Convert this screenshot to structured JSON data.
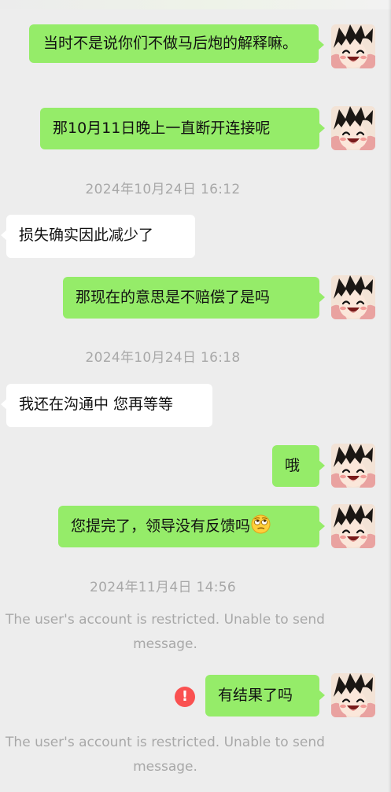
{
  "messages": [
    {
      "id": "m1",
      "text": "当时不是说你们不做马后炮的解释嘛。"
    },
    {
      "id": "m2",
      "text": "那10月11日晚上一直断开连接呢"
    },
    {
      "id": "t1",
      "text": "2024年10月24日 16:12"
    },
    {
      "id": "m3",
      "text": "损失确实因此减少了"
    },
    {
      "id": "m4",
      "text": "那现在的意思是不赔偿了是吗"
    },
    {
      "id": "t2",
      "text": "2024年10月24日 16:18"
    },
    {
      "id": "m5",
      "text": "我还在沟通中 您再等等"
    },
    {
      "id": "m6",
      "text": "哦"
    },
    {
      "id": "m7",
      "text": "您提完了，领导没有反馈吗"
    },
    {
      "id": "t3",
      "text": "2024年11月4日 14:56"
    },
    {
      "id": "s1",
      "text": "The user's account is restricted. Unable to send message."
    },
    {
      "id": "m8",
      "text": "有结果了吗"
    },
    {
      "id": "s2",
      "text": "The user's account is restricted. Unable to send message."
    }
  ],
  "icons": {
    "error": "!",
    "avatar": "anime-avatar",
    "emoji": "eye-roll-emoji"
  },
  "colors": {
    "background": "#ededed",
    "outgoing_bubble": "#95ec69",
    "incoming_bubble": "#ffffff",
    "meta_text": "#a8a8a8",
    "error_badge": "#fa5151"
  }
}
